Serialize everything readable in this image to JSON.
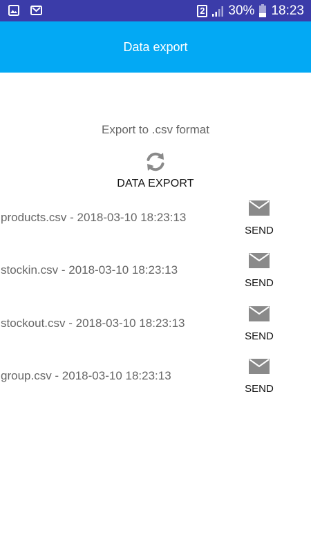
{
  "status_bar": {
    "sim": "2",
    "battery": "30%",
    "time": "18:23"
  },
  "app_bar": {
    "title": "Data export"
  },
  "main": {
    "heading": "Export to .csv format",
    "export_button_label": "DATA EXPORT",
    "files": [
      {
        "label": "products.csv - 2018-03-10 18:23:13",
        "send_label": "SEND"
      },
      {
        "label": "stockin.csv - 2018-03-10 18:23:13",
        "send_label": "SEND"
      },
      {
        "label": "stockout.csv - 2018-03-10 18:23:13",
        "send_label": "SEND"
      },
      {
        "label": "group.csv - 2018-03-10 18:23:13",
        "send_label": "SEND"
      }
    ]
  },
  "colors": {
    "status_bar": "#3B3CA9",
    "app_bar": "#03A9F4",
    "icon_gray": "#8A8A8A"
  }
}
